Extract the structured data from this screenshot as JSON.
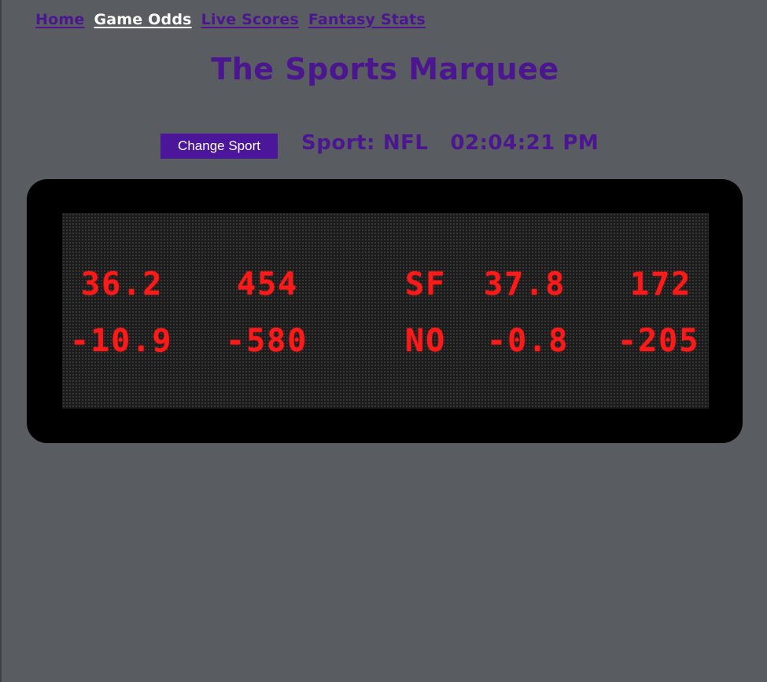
{
  "nav": {
    "items": [
      {
        "label": "Home",
        "active": false
      },
      {
        "label": "Game Odds",
        "active": true
      },
      {
        "label": "Live Scores",
        "active": false
      },
      {
        "label": "Fantasy Stats",
        "active": false
      }
    ]
  },
  "header": {
    "title": "The Sports Marquee"
  },
  "controls": {
    "change_sport_label": "Change Sport",
    "sport_label": "Sport:",
    "sport_value": "NFL",
    "clock": "02:04:21 PM"
  },
  "marquee": {
    "rows": [
      {
        "c1": "36.2",
        "c2": "454",
        "c3": "SF",
        "c4": "37.8",
        "c5": "172"
      },
      {
        "c1": "-10.9",
        "c2": "-580",
        "c3": "NO",
        "c4": "-0.8",
        "c5": "-205"
      }
    ]
  },
  "colors": {
    "background": "#595c61",
    "accent": "#4b168f",
    "active_nav": "#ffffff",
    "led": "#ff1a1a",
    "marquee_frame": "#000000"
  }
}
